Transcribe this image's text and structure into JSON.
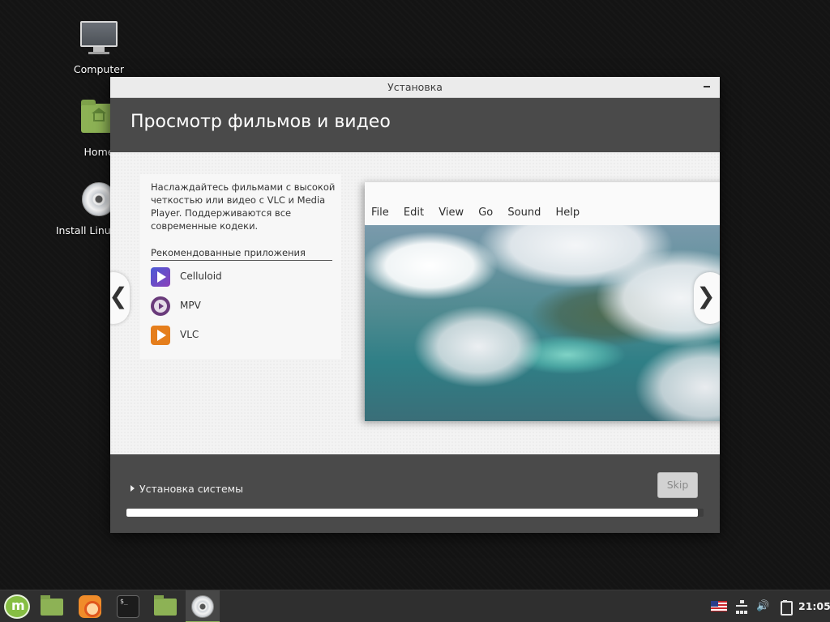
{
  "desktop": {
    "icons": [
      {
        "label": "Computer",
        "icon": "computer-icon"
      },
      {
        "label": "Home",
        "icon": "home-folder-icon"
      },
      {
        "label": "Install Linux Mint",
        "icon": "install-disc-icon"
      }
    ]
  },
  "installer": {
    "window_title": "Установка",
    "slide_title": "Просмотр фильмов и видео",
    "description": "Наслаждайтесь фильмами с высокой четкостью или видео с VLC и Media Player. Поддерживаются все современные кодеки.",
    "recommended_title": "Рекомендованные приложения",
    "apps": [
      {
        "name": "Celluloid",
        "icon": "celluloid-icon"
      },
      {
        "name": "MPV",
        "icon": "mpv-icon"
      },
      {
        "name": "VLC",
        "icon": "vlc-icon"
      }
    ],
    "preview_menu": [
      "File",
      "Edit",
      "View",
      "Go",
      "Sound",
      "Help"
    ],
    "prev_arrow": "❮",
    "next_arrow": "❯",
    "expander_label": "Установка системы",
    "skip_label": "Skip",
    "progress_fraction": 0.99
  },
  "taskbar": {
    "items": [
      {
        "name": "menu",
        "icon": "mint-menu-icon"
      },
      {
        "name": "files",
        "icon": "folder-icon"
      },
      {
        "name": "firefox",
        "icon": "firefox-icon"
      },
      {
        "name": "terminal",
        "icon": "terminal-icon",
        "glyph": "$_"
      },
      {
        "name": "files-2",
        "icon": "folder-icon"
      },
      {
        "name": "installer",
        "icon": "install-disc-icon",
        "active": true
      }
    ],
    "tray": {
      "volume_glyph": "🔊",
      "clock": "21:05"
    }
  },
  "colors": {
    "accent": "#8bb158",
    "window_dark": "#4a4a4a"
  }
}
